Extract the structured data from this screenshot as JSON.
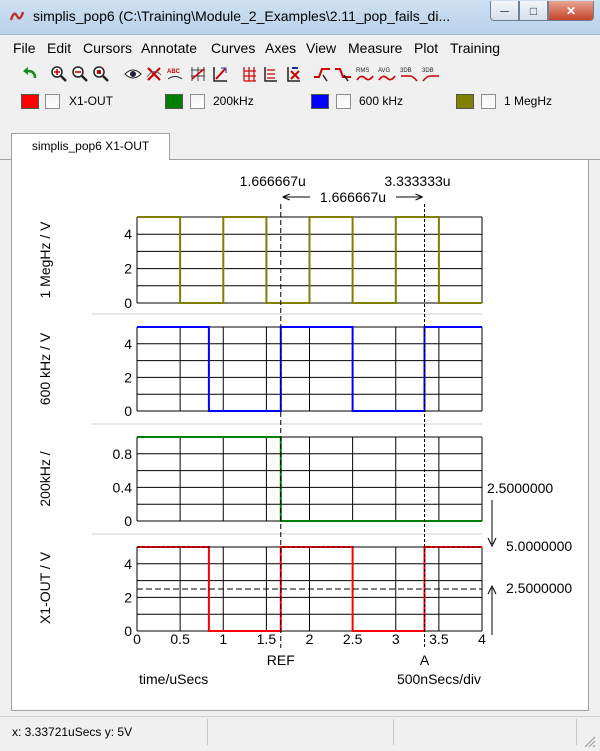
{
  "window": {
    "title": "simplis_pop6 (C:\\Training\\Module_2_Examples\\2.11_pop_fails_di..."
  },
  "menu": [
    "File",
    "Edit",
    "Cursors",
    "Annotate",
    "Curves",
    "Axes",
    "View",
    "Measure",
    "Plot",
    "Training"
  ],
  "toolbar_icons": [
    "undo-icon",
    "zoom-in-icon",
    "zoom-out-icon",
    "zoom-fit-icon",
    "eye-icon",
    "delete-curve-icon",
    "label-icon",
    "grid-icon",
    "axis-icon",
    "move-axis-icon",
    "new-axis-icon",
    "delete-axis-icon",
    "cursor-rise-icon",
    "cursor-fall-icon",
    "rms-icon",
    "avg-icon",
    "3db-low-icon",
    "3db-high-icon"
  ],
  "toolbar_labels": {
    "rms": "RMS",
    "avg": "AVG",
    "db1": "3DB",
    "db2": "3DB"
  },
  "legend": [
    {
      "name": "X1-OUT",
      "color": "#ff0000"
    },
    {
      "name": "200kHz",
      "color": "#008000"
    },
    {
      "name": "600 kHz",
      "color": "#0000ff"
    },
    {
      "name": "1 MegHz",
      "color": "#808000"
    }
  ],
  "tab": {
    "label": "simplis_pop6 X1-OUT"
  },
  "plot": {
    "cursor_ref_value": "1.666667u",
    "cursor_a_value": "3.333333u",
    "cursor_delta": "1.666667u",
    "ref_label": "REF",
    "a_label": "A",
    "x_axis_label": "time/uSecs",
    "x_div_label": "500nSecs/div",
    "x_ticks": [
      "0",
      "0.5",
      "1",
      "1.5",
      "2",
      "2.5",
      "3",
      "3.5",
      "4"
    ],
    "right_labels": {
      "r1": "2.5000000",
      "r2": "5.0000000",
      "r3": "2.5000000"
    },
    "panels": [
      {
        "ylabel": "1 MegHz / V",
        "ticks": [
          "4",
          "2",
          "0"
        ],
        "color": "#808000"
      },
      {
        "ylabel": "600 kHz / V",
        "ticks": [
          "4",
          "2",
          "0"
        ],
        "color": "#0000ff"
      },
      {
        "ylabel": "200kHz /",
        "ticks": [
          "0.8",
          "0.4",
          "0"
        ],
        "color": "#008000"
      },
      {
        "ylabel": "X1-OUT / V",
        "ticks": [
          "4",
          "2",
          "0"
        ],
        "color": "#ff0000"
      }
    ]
  },
  "status": {
    "text": "x: 3.33721uSecs  y: 5V"
  },
  "chart_data": [
    {
      "type": "line",
      "series": [
        {
          "name": "1 MegHz",
          "x": [
            0,
            0.5,
            0.5,
            1,
            1,
            1.5,
            1.5,
            2,
            2,
            2.5,
            2.5,
            3,
            3,
            3.5,
            3.5,
            4
          ],
          "y": [
            5,
            5,
            0,
            0,
            5,
            5,
            0,
            0,
            5,
            5,
            0,
            0,
            5,
            5,
            0,
            0
          ]
        }
      ],
      "xlabel": "time/uSecs",
      "ylabel": "1 MegHz / V",
      "xlim": [
        0,
        4
      ],
      "ylim": [
        0,
        5
      ],
      "grid": true
    },
    {
      "type": "line",
      "series": [
        {
          "name": "600 kHz",
          "x": [
            0,
            0.8333,
            0.8333,
            1.6667,
            1.6667,
            2.5,
            2.5,
            3.3333,
            3.3333,
            4
          ],
          "y": [
            5,
            5,
            0,
            0,
            5,
            5,
            0,
            0,
            5,
            5
          ]
        }
      ],
      "xlabel": "time/uSecs",
      "ylabel": "600 kHz / V",
      "xlim": [
        0,
        4
      ],
      "ylim": [
        0,
        5
      ],
      "grid": true
    },
    {
      "type": "line",
      "series": [
        {
          "name": "200kHz",
          "x": [
            0,
            1.6667,
            1.6667,
            4
          ],
          "y": [
            1,
            1,
            0,
            0
          ]
        }
      ],
      "xlabel": "time/uSecs",
      "ylabel": "200kHz /",
      "xlim": [
        0,
        4
      ],
      "ylim": [
        0,
        1
      ],
      "grid": true
    },
    {
      "type": "line",
      "series": [
        {
          "name": "X1-OUT",
          "x": [
            0,
            0.8333,
            0.8333,
            1.6667,
            1.6667,
            2.5,
            2.5,
            3.3333,
            3.3333,
            4
          ],
          "y": [
            5,
            5,
            0,
            0,
            5,
            5,
            0,
            0,
            5,
            5
          ]
        }
      ],
      "xlabel": "time/uSecs",
      "ylabel": "X1-OUT / V",
      "xlim": [
        0,
        4
      ],
      "ylim": [
        0,
        5
      ],
      "grid": true
    }
  ]
}
